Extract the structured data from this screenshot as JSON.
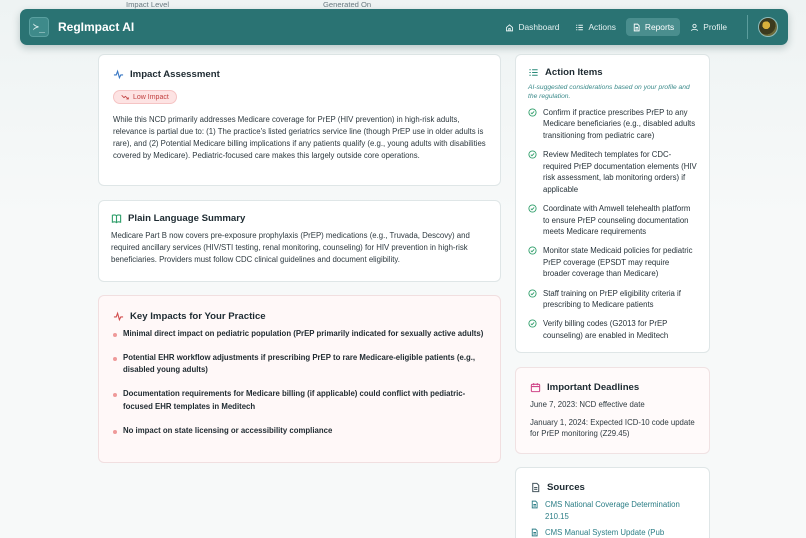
{
  "app": {
    "title": "RegImpact AI",
    "logo_glyph": "≻_"
  },
  "peek": {
    "col1_label": "Impact Level",
    "col2_label": "Generated On"
  },
  "nav": {
    "items": [
      {
        "label": "Dashboard",
        "icon": "home-icon",
        "active": false
      },
      {
        "label": "Actions",
        "icon": "list-icon",
        "active": false
      },
      {
        "label": "Reports",
        "icon": "document-icon",
        "active": true
      },
      {
        "label": "Profile",
        "icon": "user-icon",
        "active": false
      }
    ]
  },
  "impact_assessment": {
    "title": "Impact Assessment",
    "badge": "Low Impact",
    "text": "While this NCD primarily addresses Medicare coverage for PrEP (HIV prevention) in high-risk adults, relevance is partial due to: (1) The practice's listed geriatrics service line (though PrEP use in older adults is rare), and (2) Potential Medicare billing implications if any patients qualify (e.g., young adults with disabilities covered by Medicare). Pediatric-focused care makes this largely outside core operations."
  },
  "plain_summary": {
    "title": "Plain Language Summary",
    "text": "Medicare Part B now covers pre-exposure prophylaxis (PrEP) medications (e.g., Truvada, Descovy) and required ancillary services (HIV/STI testing, renal monitoring, counseling) for HIV prevention in high-risk beneficiaries. Providers must follow CDC clinical guidelines and document eligibility."
  },
  "key_impacts": {
    "title": "Key Impacts for Your Practice",
    "items": [
      "Minimal direct impact on pediatric population (PrEP primarily indicated for sexually active adults)",
      "Potential EHR workflow adjustments if prescribing PrEP to rare Medicare-eligible patients (e.g., disabled young adults)",
      "Documentation requirements for Medicare billing (if applicable) could conflict with pediatric-focused EHR templates in Meditech",
      "No impact on state licensing or accessibility compliance"
    ]
  },
  "action_items": {
    "title": "Action Items",
    "note": "AI-suggested considerations based on your profile and the regulation.",
    "items": [
      "Confirm if practice prescribes PrEP to any Medicare beneficiaries (e.g., disabled adults transitioning from pediatric care)",
      "Review Meditech templates for CDC-required PrEP documentation elements (HIV risk assessment, lab monitoring orders) if applicable",
      "Coordinate with Amwell telehealth platform to ensure PrEP counseling documentation meets Medicare requirements",
      "Monitor state Medicaid policies for pediatric PrEP coverage (EPSDT may require broader coverage than Medicare)",
      "Staff training on PrEP eligibility criteria if prescribing to Medicare patients",
      "Verify billing codes (G2013 for PrEP counseling) are enabled in Meditech"
    ]
  },
  "deadlines": {
    "title": "Important Deadlines",
    "items": [
      "June 7, 2023: NCD effective date",
      "January 1, 2024: Expected ICD-10 code update for PrEP monitoring (Z29.45)"
    ]
  },
  "sources": {
    "title": "Sources",
    "items": [
      "CMS National Coverage Determination 210.15",
      "CMS Manual System Update (Pub"
    ]
  },
  "colors": {
    "brand": "#2a7373",
    "accent_teal": "#2c7e86",
    "impact_red": "#c14141",
    "check_green": "#2f9e6a"
  }
}
